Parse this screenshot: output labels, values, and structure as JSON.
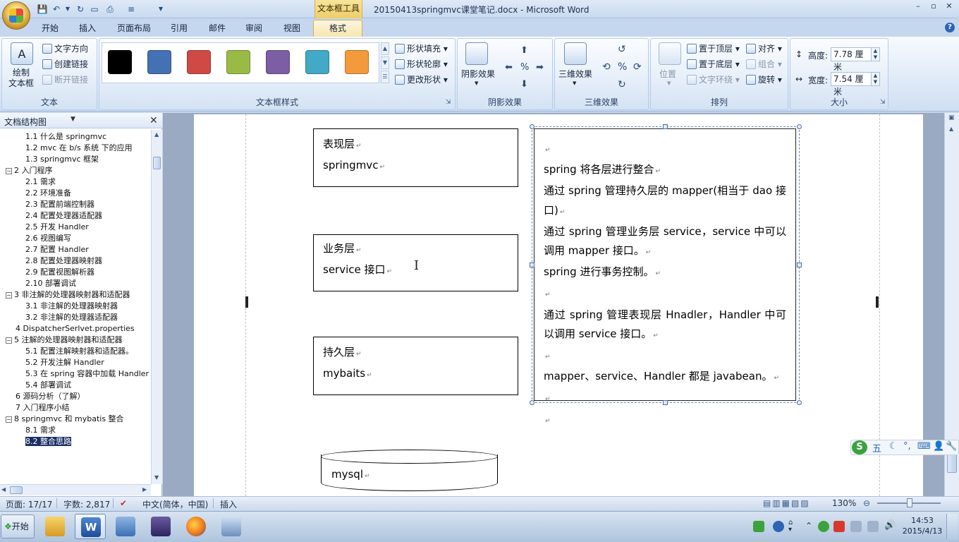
{
  "window": {
    "title": "20150413springmvc课堂笔记.docx - Microsoft Word",
    "context_tab_title": "文本框工具",
    "controls": [
      "–",
      "▫",
      "✕"
    ]
  },
  "tabs": {
    "home": "开始",
    "insert": "插入",
    "page_layout": "页面布局",
    "references": "引用",
    "mailings": "邮件",
    "review": "审阅",
    "view": "视图",
    "format": "格式"
  },
  "ribbon": {
    "text_group": {
      "label": "文本",
      "draw_textbox": "绘制\n文本框",
      "text_direction": "文字方向",
      "create_link": "创建链接",
      "break_link": "断开链接"
    },
    "styles_group": {
      "label": "文本框样式",
      "swatches": [
        "#000000",
        "#4470b4",
        "#cf4a45",
        "#99bb45",
        "#7c5ea4",
        "#42a9c6",
        "#f39a3d"
      ],
      "shape_fill": "形状填充",
      "shape_outline": "形状轮廓",
      "change_shape": "更改形状"
    },
    "shadow_group": {
      "label": "阴影效果",
      "shadow_effects": "阴影效果"
    },
    "threed_group": {
      "label": "三维效果",
      "threed_effects": "三维效果"
    },
    "arrange_group": {
      "label": "排列",
      "position": "位置",
      "bring_front": "置于顶层",
      "send_back": "置于底层",
      "text_wrap": "文字环绕",
      "align": "对齐",
      "group": "组合",
      "rotate": "旋转"
    },
    "size_group": {
      "label": "大小",
      "height_label": "高度:",
      "height_value": "7.78 厘米",
      "width_label": "宽度:",
      "width_value": "7.54 厘米"
    }
  },
  "nav": {
    "title": "文档结构图",
    "items": [
      {
        "text": "1.1 什么是 springmvc",
        "level": 2,
        "exp": ""
      },
      {
        "text": "1.2 mvc 在 b/s 系统 下的应用",
        "level": 2,
        "exp": ""
      },
      {
        "text": "1.3 springmvc 框架",
        "level": 2,
        "exp": ""
      },
      {
        "text": "2 入门程序",
        "level": 1,
        "exp": "−"
      },
      {
        "text": "2.1 需求",
        "level": 2,
        "exp": ""
      },
      {
        "text": "2.2 环境准备",
        "level": 2,
        "exp": ""
      },
      {
        "text": "2.3 配置前端控制器",
        "level": 2,
        "exp": ""
      },
      {
        "text": "2.4 配置处理器适配器",
        "level": 2,
        "exp": ""
      },
      {
        "text": "2.5 开发 Handler",
        "level": 2,
        "exp": ""
      },
      {
        "text": "2.6 视图编写",
        "level": 2,
        "exp": ""
      },
      {
        "text": "2.7 配置 Handler",
        "level": 2,
        "exp": ""
      },
      {
        "text": "2.8 配置处理器映射器",
        "level": 2,
        "exp": ""
      },
      {
        "text": "2.9 配置视图解析器",
        "level": 2,
        "exp": ""
      },
      {
        "text": "2.10 部署调试",
        "level": 2,
        "exp": ""
      },
      {
        "text": "3 非注解的处理器映射器和适配器",
        "level": 1,
        "exp": "−"
      },
      {
        "text": "3.1 非注解的处理器映射器",
        "level": 2,
        "exp": ""
      },
      {
        "text": "3.2 非注解的处理器适配器",
        "level": 2,
        "exp": ""
      },
      {
        "text": "4 DispatcherSerlvet.properties",
        "level": 1.5,
        "exp": ""
      },
      {
        "text": "5 注解的处理器映射器和适配器",
        "level": 1,
        "exp": "−"
      },
      {
        "text": "5.1 配置注解映射器和适配器。",
        "level": 2,
        "exp": ""
      },
      {
        "text": "5.2 开发注解 Handler",
        "level": 2,
        "exp": ""
      },
      {
        "text": "5.3 在 spring 容器中加载 Handler",
        "level": 2,
        "exp": ""
      },
      {
        "text": "5.4 部署调试",
        "level": 2,
        "exp": ""
      },
      {
        "text": "6 源码分析（了解）",
        "level": 1.5,
        "exp": ""
      },
      {
        "text": "7 入门程序小结",
        "level": 1.5,
        "exp": ""
      },
      {
        "text": "8 springmvc 和 mybatis 整合",
        "level": 1,
        "exp": "−"
      },
      {
        "text": "8.1 需求",
        "level": 2,
        "exp": ""
      },
      {
        "text": "8.2 整合思路",
        "level": 2,
        "exp": "",
        "selected": true
      }
    ]
  },
  "doc": {
    "layers": [
      {
        "title": "表现层",
        "sub": "springmvc"
      },
      {
        "title": "业务层",
        "sub": "service 接口"
      },
      {
        "title": "持久层",
        "sub": "mybaits"
      }
    ],
    "db_label": "mysql",
    "textbox_lines": [
      "",
      "spring 将各层进行整合",
      "通过 spring 管理持久层的 mapper(相当于 dao 接口)",
      "通过 spring 管理业务层 service，service 中可以调用 mapper 接口。",
      "spring 进行事务控制。",
      "",
      "通过 spring 管理表现层 Hnadler，Handler 中可以调用 service 接口。",
      "",
      "mapper、service、Handler 都是 javabean。",
      "",
      ""
    ],
    "para_mark": "↵"
  },
  "ime": {
    "label": "五"
  },
  "status": {
    "page": "页面: 17/17",
    "words": "字数: 2,817",
    "language": "中文(简体，中国)",
    "mode": "插入",
    "zoom": "130%"
  },
  "taskbar": {
    "start": "开始",
    "time": "14:53",
    "date": "2015/4/13"
  }
}
